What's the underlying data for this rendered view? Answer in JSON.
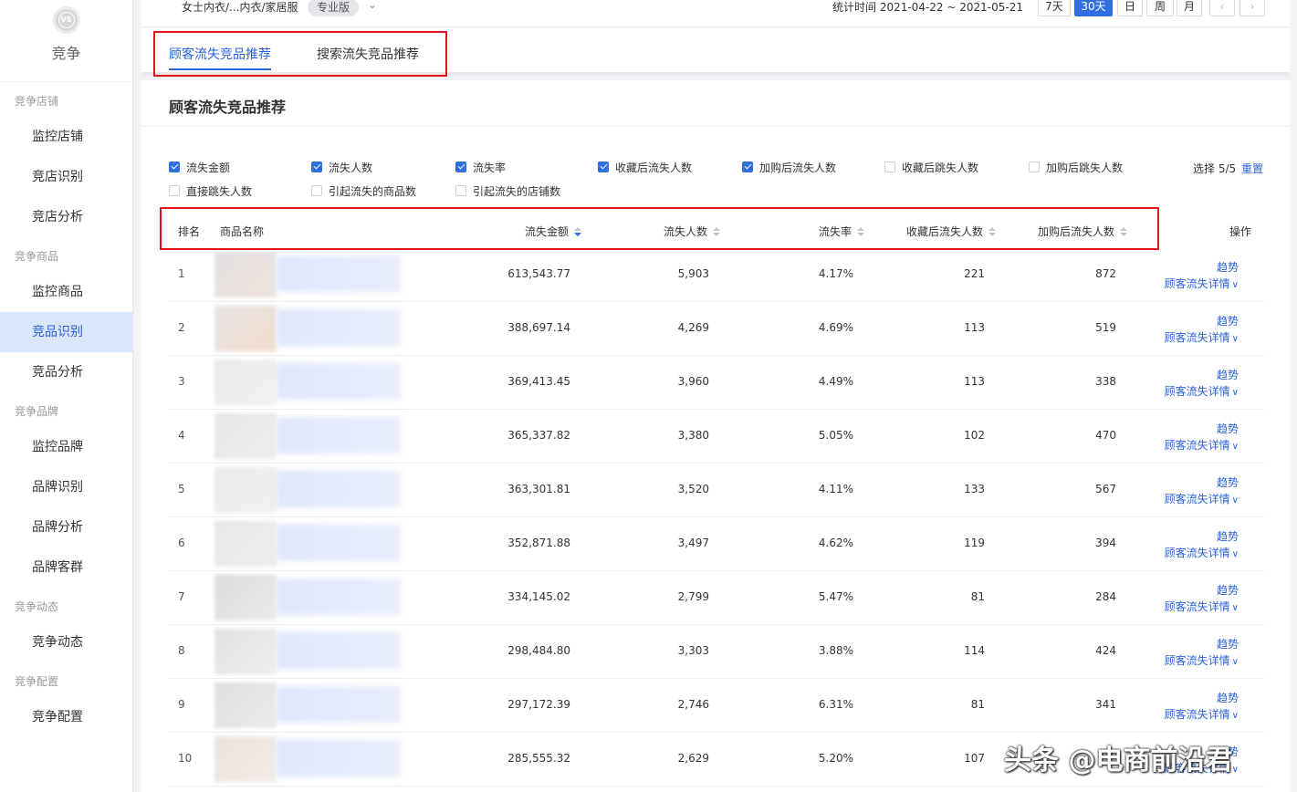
{
  "sidebar": {
    "brand": "竞争",
    "logo_text": "VS",
    "groups": [
      {
        "title": "竞争店铺",
        "items": [
          {
            "label": "监控店铺"
          },
          {
            "label": "竞店识别"
          },
          {
            "label": "竞店分析"
          }
        ]
      },
      {
        "title": "竞争商品",
        "items": [
          {
            "label": "监控商品"
          },
          {
            "label": "竞品识别",
            "active": true
          },
          {
            "label": "竞品分析"
          }
        ]
      },
      {
        "title": "竞争品牌",
        "items": [
          {
            "label": "监控品牌"
          },
          {
            "label": "品牌识别"
          },
          {
            "label": "品牌分析"
          },
          {
            "label": "品牌客群"
          }
        ]
      },
      {
        "title": "竞争动态",
        "items": [
          {
            "label": "竞争动态"
          }
        ]
      },
      {
        "title": "竞争配置",
        "items": [
          {
            "label": "竞争配置"
          }
        ]
      }
    ]
  },
  "topbar": {
    "category": "女士内衣/...内衣/家居服",
    "edition": "专业版",
    "stat_label": "统计时间 2021-04-22 ~ 2021-05-21",
    "ranges": [
      "7天",
      "30天",
      "日",
      "周",
      "月"
    ],
    "active_range": "30天"
  },
  "tabs": [
    "顾客流失竞品推荐",
    "搜索流失竞品推荐"
  ],
  "section_title": "顾客流失竞品推荐",
  "filters": [
    {
      "label": "流失金额",
      "checked": true
    },
    {
      "label": "流失人数",
      "checked": true
    },
    {
      "label": "流失率",
      "checked": true
    },
    {
      "label": "收藏后流失人数",
      "checked": true
    },
    {
      "label": "加购后流失人数",
      "checked": true
    },
    {
      "label": "收藏后跳失人数",
      "checked": false
    },
    {
      "label": "加购后跳失人数",
      "checked": false
    },
    {
      "label": "直接跳失人数",
      "checked": false
    },
    {
      "label": "引起流失的商品数",
      "checked": false
    },
    {
      "label": "引起流失的店铺数",
      "checked": false
    }
  ],
  "select_count": "选择 5/5",
  "reset_label": "重置",
  "table": {
    "headers": {
      "rank": "排名",
      "name": "商品名称",
      "amount": "流失金额",
      "people": "流失人数",
      "rate": "流失率",
      "fav_lost": "收藏后流失人数",
      "cart_lost": "加购后流失人数",
      "action": "操作"
    },
    "trend_label": "趋势",
    "detail_label": "顾客流失详情",
    "rows": [
      {
        "rank": "1",
        "amount": "613,543.77",
        "people": "5,903",
        "rate": "4.17%",
        "fav": "221",
        "cart": "872"
      },
      {
        "rank": "2",
        "amount": "388,697.14",
        "people": "4,269",
        "rate": "4.69%",
        "fav": "113",
        "cart": "519"
      },
      {
        "rank": "3",
        "amount": "369,413.45",
        "people": "3,960",
        "rate": "4.49%",
        "fav": "113",
        "cart": "338"
      },
      {
        "rank": "4",
        "amount": "365,337.82",
        "people": "3,380",
        "rate": "5.05%",
        "fav": "102",
        "cart": "470"
      },
      {
        "rank": "5",
        "amount": "363,301.81",
        "people": "3,520",
        "rate": "4.11%",
        "fav": "133",
        "cart": "567"
      },
      {
        "rank": "6",
        "amount": "352,871.88",
        "people": "3,497",
        "rate": "4.62%",
        "fav": "119",
        "cart": "394"
      },
      {
        "rank": "7",
        "amount": "334,145.02",
        "people": "2,799",
        "rate": "5.47%",
        "fav": "81",
        "cart": "284"
      },
      {
        "rank": "8",
        "amount": "298,484.80",
        "people": "3,303",
        "rate": "3.88%",
        "fav": "114",
        "cart": "424"
      },
      {
        "rank": "9",
        "amount": "297,172.39",
        "people": "2,746",
        "rate": "6.31%",
        "fav": "81",
        "cart": "341"
      },
      {
        "rank": "10",
        "amount": "285,555.32",
        "people": "2,629",
        "rate": "5.20%",
        "fav": "107",
        "cart": ""
      }
    ]
  },
  "watermark": "头条 @电商前沿君"
}
